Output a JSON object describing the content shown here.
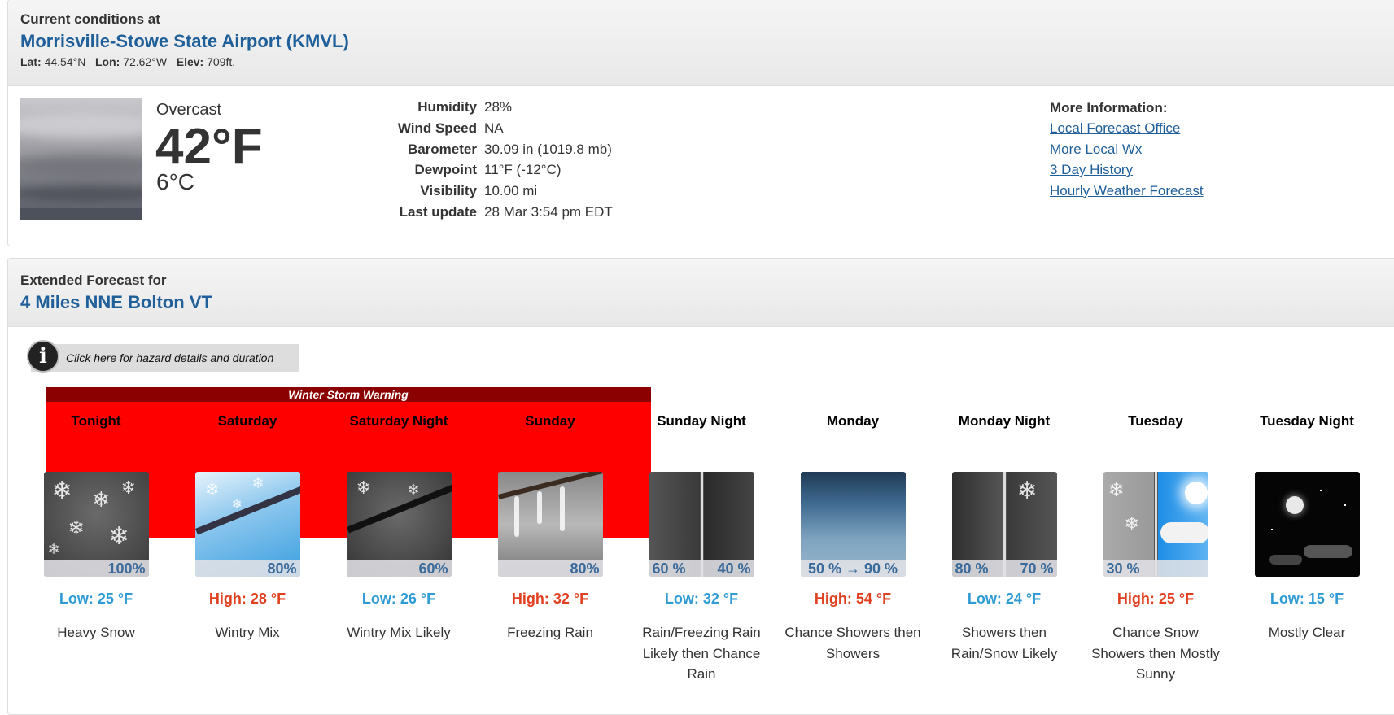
{
  "current": {
    "header_small": "Current conditions at",
    "station": "Morrisville-Stowe State Airport (KMVL)",
    "lat_label": "Lat:",
    "lat": "44.54°N",
    "lon_label": "Lon:",
    "lon": "72.62°W",
    "elev_label": "Elev:",
    "elev": "709ft.",
    "condition": "Overcast",
    "temp_f": "42°F",
    "temp_c": "6°C",
    "details": [
      {
        "label": "Humidity",
        "value": "28%"
      },
      {
        "label": "Wind Speed",
        "value": "NA"
      },
      {
        "label": "Barometer",
        "value": "30.09 in (1019.8 mb)"
      },
      {
        "label": "Dewpoint",
        "value": "11°F (-12°C)"
      },
      {
        "label": "Visibility",
        "value": "10.00 mi"
      },
      {
        "label": "Last update",
        "value": "28 Mar 3:54 pm EDT"
      }
    ],
    "more_title": "More Information:",
    "more_links": [
      "Local Forecast Office",
      "More Local Wx",
      "3 Day History",
      "Hourly Weather Forecast"
    ]
  },
  "extended": {
    "header_small": "Extended Forecast for",
    "location": "4 Miles NNE Bolton VT",
    "hazard_link": "Click here for hazard details and duration",
    "warning": "Winter Storm Warning",
    "periods": [
      {
        "name": "Tonight",
        "pct_left": "",
        "pct_right": "",
        "pct_single": "100%",
        "temp": "Low: 25 °F",
        "temp_kind": "low",
        "desc": "Heavy Snow",
        "icon": "heavy-snow-icon"
      },
      {
        "name": "Saturday",
        "pct_left": "",
        "pct_right": "",
        "pct_single": "80%",
        "temp": "High: 28 °F",
        "temp_kind": "high",
        "desc": "Wintry Mix",
        "icon": "wintry-mix-icon"
      },
      {
        "name": "Saturday Night",
        "pct_left": "",
        "pct_right": "",
        "pct_single": "60%",
        "temp": "Low: 26 °F",
        "temp_kind": "low",
        "desc": "Wintry Mix Likely",
        "icon": "wintry-mix-night-icon"
      },
      {
        "name": "Sunday",
        "pct_left": "",
        "pct_right": "",
        "pct_single": "80%",
        "temp": "High: 32 °F",
        "temp_kind": "high",
        "desc": "Freezing Rain",
        "icon": "freezing-rain-icon"
      },
      {
        "name": "Sunday Night",
        "pct_left": "60 %",
        "pct_right": "40 %",
        "pct_single": "",
        "temp": "Low: 32 °F",
        "temp_kind": "low",
        "desc": "Rain/Freezing Rain Likely then Chance Rain",
        "icon": "freezing-rain-to-rain-icon"
      },
      {
        "name": "Monday",
        "pct_left": "",
        "pct_right": "",
        "pct_single": "50 % → 90 %",
        "temp": "High: 54 °F",
        "temp_kind": "high",
        "desc": "Chance Showers then Showers",
        "icon": "showers-icon"
      },
      {
        "name": "Monday Night",
        "pct_left": "80 %",
        "pct_right": "70 %",
        "pct_single": "",
        "temp": "Low: 24 °F",
        "temp_kind": "low",
        "desc": "Showers then Rain/Snow Likely",
        "icon": "showers-to-rain-snow-icon"
      },
      {
        "name": "Tuesday",
        "pct_left": "30 %",
        "pct_right": "",
        "pct_single": "",
        "temp": "High: 25 °F",
        "temp_kind": "high",
        "desc": "Chance Snow Showers then Mostly Sunny",
        "icon": "snow-to-sunny-icon"
      },
      {
        "name": "Tuesday Night",
        "pct_left": "",
        "pct_right": "",
        "pct_single": "",
        "temp": "Low: 15 °F",
        "temp_kind": "low",
        "desc": "Mostly Clear",
        "icon": "mostly-clear-night-icon"
      }
    ]
  },
  "colors": {
    "link": "#1f5f9a",
    "low": "#2f9bd4",
    "high": "#e04020",
    "warning": "#ff0000",
    "warning_bar": "#8b0000"
  }
}
